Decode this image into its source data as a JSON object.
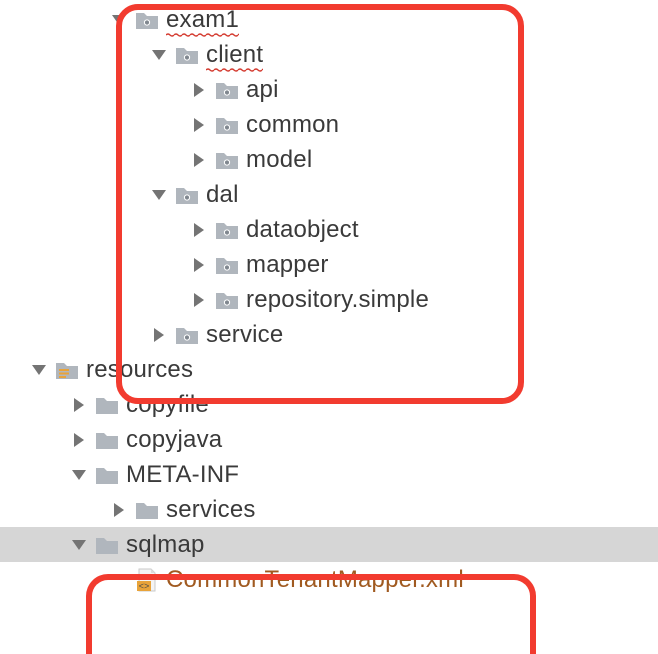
{
  "tree": {
    "exam1": "exam1",
    "client": "client",
    "api": "api",
    "common": "common",
    "model": "model",
    "dal": "dal",
    "dataobject": "dataobject",
    "mapper": "mapper",
    "repository_simple": "repository.simple",
    "service": "service",
    "resources": "resources",
    "copyfile": "copyfile",
    "copyjava": "copyjava",
    "meta_inf": "META-INF",
    "services": "services",
    "sqlmap": "sqlmap",
    "mapper_file": "CommonTenantMapper.xml"
  },
  "icons": {
    "folder_color": "#b0b6bd",
    "folder_dot": "#80878f",
    "package_mark": "#e8a33a",
    "resources_mark": "#e8a33a",
    "file_body": "#f2f2f2",
    "file_tag": "#e8a33a",
    "file_angles": "#555"
  },
  "arrow_color": "#747474"
}
